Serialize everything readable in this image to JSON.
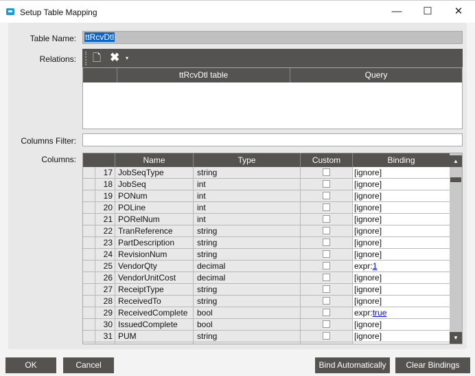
{
  "window": {
    "title": "Setup Table Mapping",
    "minimize": "—",
    "maximize": "☐",
    "close": "✕"
  },
  "labels": {
    "table_name": "Table Name:",
    "relations": "Relations:",
    "columns_filter": "Columns Filter:",
    "columns": "Columns:"
  },
  "table_name_value": "ttRcvDtl",
  "columns_filter_value": "",
  "relations": {
    "headers": [
      "ttRcvDtl table",
      "Query"
    ]
  },
  "columns": {
    "headers": [
      "Name",
      "Type",
      "Custom",
      "Binding"
    ],
    "rows": [
      {
        "num": "17",
        "name": "JobSeqType",
        "type": "string",
        "binding": "[ignore]"
      },
      {
        "num": "18",
        "name": "JobSeq",
        "type": "int",
        "binding": "[ignore]"
      },
      {
        "num": "19",
        "name": "PONum",
        "type": "int",
        "binding": "[ignore]"
      },
      {
        "num": "20",
        "name": "POLine",
        "type": "int",
        "binding": "[ignore]"
      },
      {
        "num": "21",
        "name": "PORelNum",
        "type": "int",
        "binding": "[ignore]"
      },
      {
        "num": "22",
        "name": "TranReference",
        "type": "string",
        "binding": "[ignore]"
      },
      {
        "num": "23",
        "name": "PartDescription",
        "type": "string",
        "binding": "[ignore]"
      },
      {
        "num": "24",
        "name": "RevisionNum",
        "type": "string",
        "binding": "[ignore]"
      },
      {
        "num": "25",
        "name": "VendorQty",
        "type": "decimal",
        "binding_prefix": "expr:",
        "binding_link": "1"
      },
      {
        "num": "26",
        "name": "VendorUnitCost",
        "type": "decimal",
        "binding": "[ignore]"
      },
      {
        "num": "27",
        "name": "ReceiptType",
        "type": "string",
        "binding": "[ignore]"
      },
      {
        "num": "28",
        "name": "ReceivedTo",
        "type": "string",
        "binding": "[ignore]"
      },
      {
        "num": "29",
        "name": "ReceivedComplete",
        "type": "bool",
        "binding_prefix": "expr:",
        "binding_link": "true"
      },
      {
        "num": "30",
        "name": "IssuedComplete",
        "type": "bool",
        "binding": "[ignore]"
      },
      {
        "num": "31",
        "name": "PUM",
        "type": "string",
        "binding": "[ignore]"
      }
    ]
  },
  "buttons": {
    "ok": "OK",
    "cancel": "Cancel",
    "bind_auto": "Bind Automatically",
    "clear": "Clear Bindings"
  }
}
